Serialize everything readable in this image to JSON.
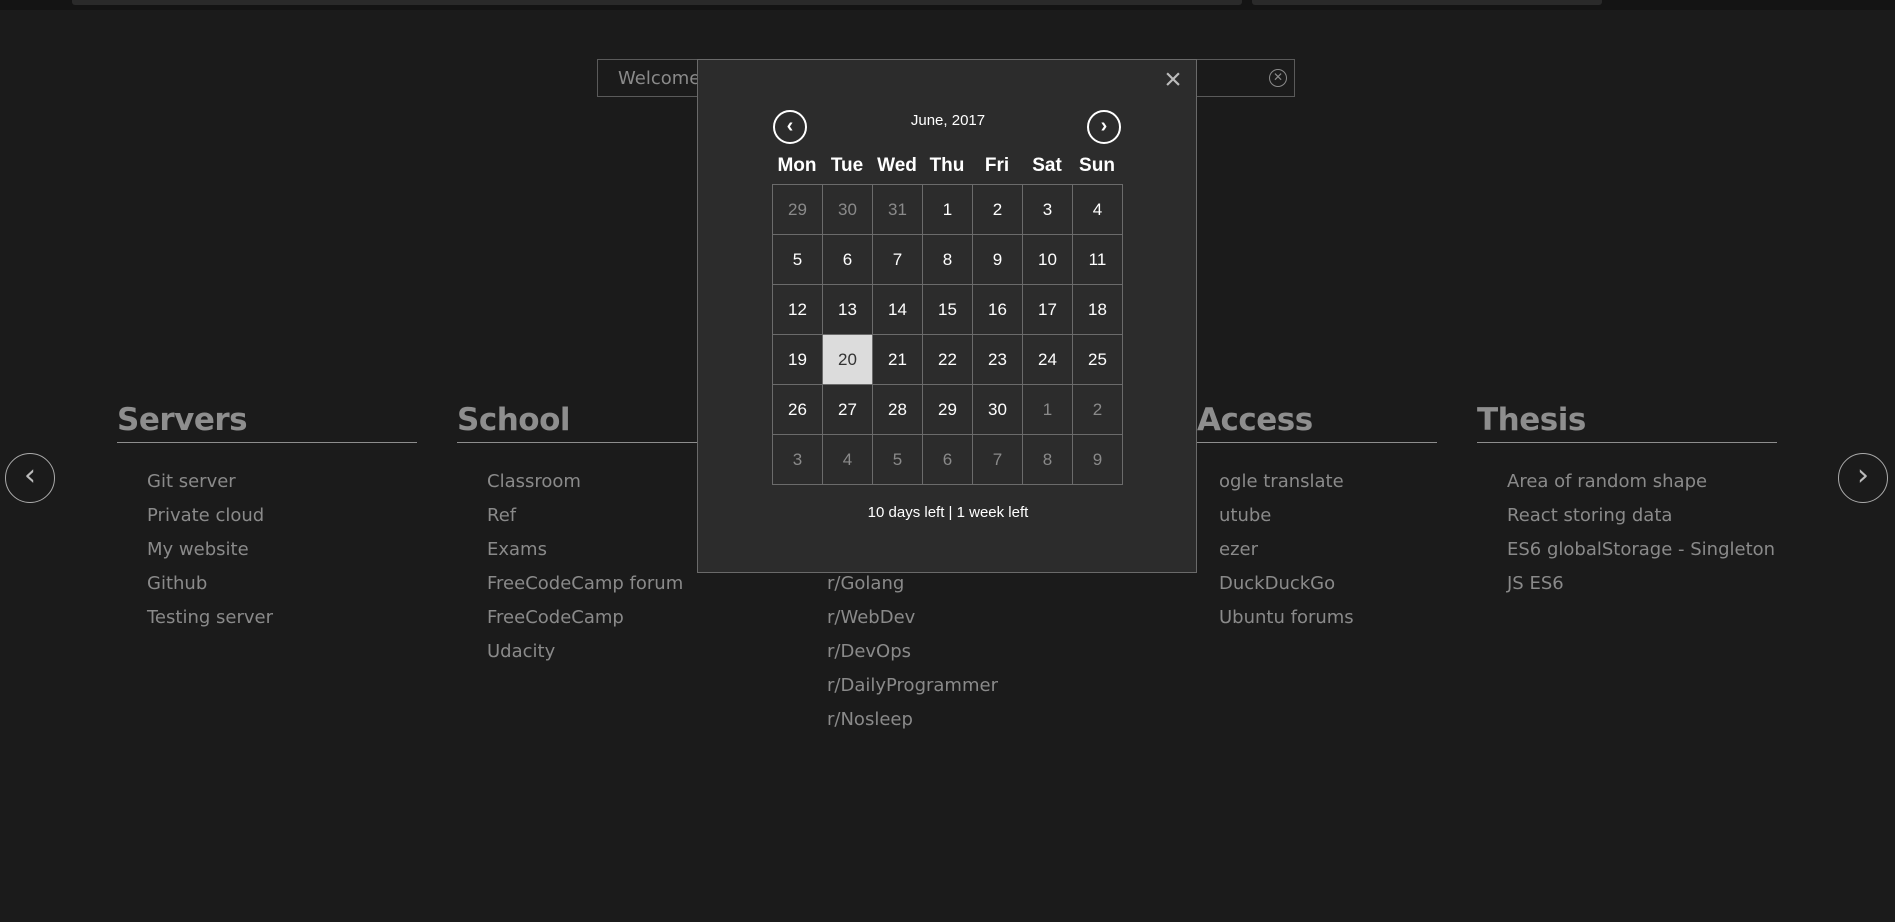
{
  "search": {
    "value": "Welcome",
    "clear_icon": "clear-circle-icon"
  },
  "categories": [
    {
      "title": "Servers",
      "items": [
        "Git server",
        "Private cloud",
        "My website",
        "Github",
        "Testing server"
      ]
    },
    {
      "title": "School",
      "items": [
        "Classroom",
        "Ref",
        "Exams",
        "FreeCodeCamp forum",
        "FreeCodeCamp",
        "Udacity"
      ]
    },
    {
      "title": "",
      "items": [
        "",
        "",
        "",
        "r/Golang",
        "r/WebDev",
        "r/DevOps",
        "r/DailyProgrammer",
        "r/Nosleep"
      ]
    },
    {
      "title": "Access",
      "items": [
        "ogle translate",
        "utube",
        "ezer",
        "DuckDuckGo",
        "Ubuntu forums"
      ]
    },
    {
      "title": "Thesis",
      "items": [
        "Area of random shape",
        "React storing data",
        "ES6 globalStorage - Singleton",
        "JS ES6"
      ]
    }
  ],
  "nav": {
    "prev_icon": "chevron-left-icon",
    "next_icon": "chevron-right-icon"
  },
  "calendar": {
    "month_label": "June, 2017",
    "weekdays": [
      "Mon",
      "Tue",
      "Wed",
      "Thu",
      "Fri",
      "Sat",
      "Sun"
    ],
    "today": "20",
    "days": [
      {
        "d": "29",
        "muted": true
      },
      {
        "d": "30",
        "muted": true
      },
      {
        "d": "31",
        "muted": true
      },
      {
        "d": "1"
      },
      {
        "d": "2"
      },
      {
        "d": "3"
      },
      {
        "d": "4"
      },
      {
        "d": "5"
      },
      {
        "d": "6"
      },
      {
        "d": "7"
      },
      {
        "d": "8"
      },
      {
        "d": "9"
      },
      {
        "d": "10"
      },
      {
        "d": "11"
      },
      {
        "d": "12"
      },
      {
        "d": "13"
      },
      {
        "d": "14"
      },
      {
        "d": "15"
      },
      {
        "d": "16"
      },
      {
        "d": "17"
      },
      {
        "d": "18"
      },
      {
        "d": "19"
      },
      {
        "d": "20",
        "today": true
      },
      {
        "d": "21"
      },
      {
        "d": "22"
      },
      {
        "d": "23"
      },
      {
        "d": "24"
      },
      {
        "d": "25"
      },
      {
        "d": "26"
      },
      {
        "d": "27"
      },
      {
        "d": "28"
      },
      {
        "d": "29"
      },
      {
        "d": "30"
      },
      {
        "d": "1",
        "muted": true
      },
      {
        "d": "2",
        "muted": true
      },
      {
        "d": "3",
        "muted": true
      },
      {
        "d": "4",
        "muted": true
      },
      {
        "d": "5",
        "muted": true
      },
      {
        "d": "6",
        "muted": true
      },
      {
        "d": "7",
        "muted": true
      },
      {
        "d": "8",
        "muted": true
      },
      {
        "d": "9",
        "muted": true
      }
    ],
    "footer": "10 days left | 1 week left"
  },
  "colors": {
    "background": "#1b1b1b",
    "modal": "#2c2c2c",
    "today": "#dcdcdc",
    "muted_text": "#8a8a8a"
  }
}
